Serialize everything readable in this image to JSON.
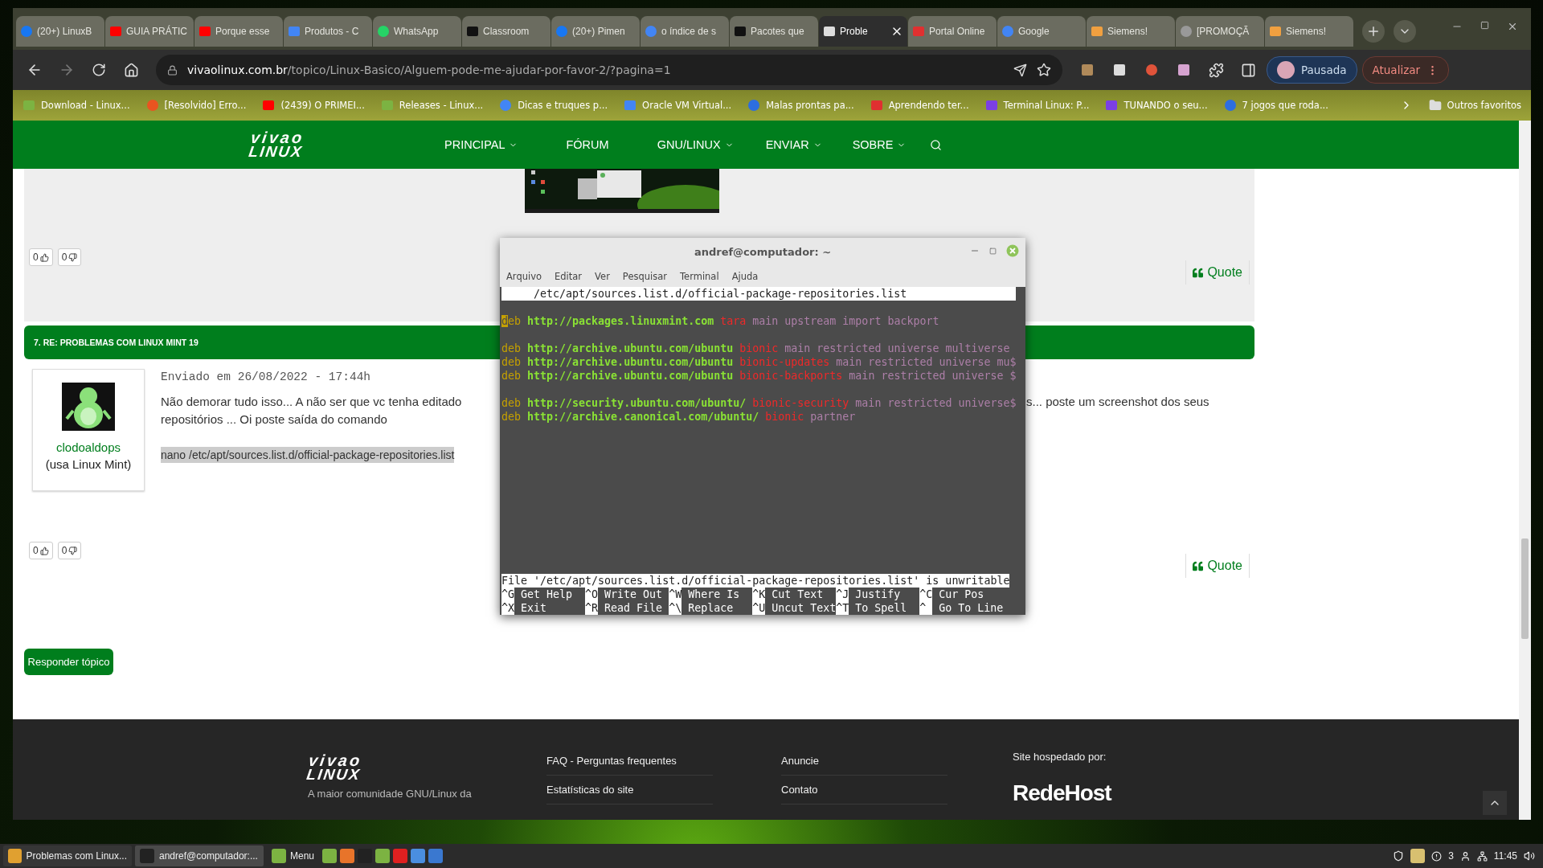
{
  "browser": {
    "tabs": [
      {
        "title": "(20+) LinuxB",
        "kind": "facebook",
        "selected": false
      },
      {
        "title": "GUIA PRÁTIC",
        "kind": "youtube",
        "selected": false
      },
      {
        "title": "Porque esse",
        "kind": "youtube",
        "selected": false
      },
      {
        "title": "Produtos - C",
        "kind": "doc",
        "selected": false
      },
      {
        "title": "WhatsApp",
        "kind": "whatsapp",
        "selected": false
      },
      {
        "title": "Classroom",
        "kind": "dark",
        "selected": false
      },
      {
        "title": "(20+) Pimen",
        "kind": "facebook",
        "selected": false
      },
      {
        "title": "o índice de s",
        "kind": "google",
        "selected": false
      },
      {
        "title": "Pacotes que",
        "kind": "dark",
        "selected": false
      },
      {
        "title": "Proble",
        "kind": "penguin",
        "selected": true
      },
      {
        "title": "Portal Online",
        "kind": "red",
        "selected": false
      },
      {
        "title": "Google",
        "kind": "google",
        "selected": false
      },
      {
        "title": "Siemens!",
        "kind": "orange",
        "selected": false
      },
      {
        "title": "[PROMOÇÃ",
        "kind": "globe",
        "selected": false
      },
      {
        "title": "Siemens!",
        "kind": "orange",
        "selected": false
      }
    ],
    "address": {
      "domain": "vivaolinux.com.br",
      "path": "/topico/Linux-Basico/Alguem-pode-me-ajudar-por-favor-2/?pagina=1"
    },
    "profile": "Pausada",
    "update": "Atualizar",
    "bookmarks": [
      {
        "title": "Download - Linux...",
        "kind": "mint"
      },
      {
        "title": "[Resolvido] Erro...",
        "kind": "ubuntu"
      },
      {
        "title": "(2439) O PRIMEI...",
        "kind": "youtube"
      },
      {
        "title": "Releases - Linux...",
        "kind": "mint"
      },
      {
        "title": "Dicas e truques p...",
        "kind": "google"
      },
      {
        "title": "Oracle VM Virtual...",
        "kind": "doc"
      },
      {
        "title": "Malas prontas pa...",
        "kind": "blue"
      },
      {
        "title": "Aprendendo ter...",
        "kind": "red"
      },
      {
        "title": "Terminal Linux: P...",
        "kind": "purple"
      },
      {
        "title": "TUNANDO o seu...",
        "kind": "purple"
      },
      {
        "title": "7 jogos que roda...",
        "kind": "blue"
      }
    ],
    "other_bookmarks": "Outros favoritos"
  },
  "site": {
    "logo": [
      "vivao",
      "LINUX"
    ],
    "nav": [
      {
        "label": "PRINCIPAL",
        "dropdown": true
      },
      {
        "label": "FÓRUM",
        "dropdown": false
      },
      {
        "label": "GNU/LINUX",
        "dropdown": true
      },
      {
        "label": "ENVIAR",
        "dropdown": true
      },
      {
        "label": "SOBRE",
        "dropdown": true
      }
    ],
    "previous_post": {
      "likes": "0",
      "dislikes": "0",
      "quote": "Quote"
    },
    "post": {
      "header": "7. RE: PROBLEMAS COM LINUX MINT 19",
      "author": "clodoaldops",
      "author_note": "(usa Linux Mint)",
      "date": "Enviado em 26/08/2022 - 17:44h",
      "line1_left": "Não demorar tudo isso... A não ser que vc tenha editado",
      "line1_right": "s... poste um screenshot dos seus",
      "line2": "repositórios ... Oi poste saída do comando",
      "code": "nano /etc/apt/sources.list.d/official-package-repositories.list",
      "likes": "0",
      "dislikes": "0",
      "quote": "Quote"
    },
    "reply_button": "Responder tópico",
    "footer": {
      "logo": [
        "vivao",
        "LINUX"
      ],
      "tagline": "A maior comunidade GNU/Linux da",
      "links_1": [
        "FAQ - Perguntas frequentes",
        "Estatísticas do site"
      ],
      "links_2": [
        "Anuncie",
        "Contato"
      ],
      "hosted_by": "Site hospedado por:",
      "host_logo": "RedeHost"
    }
  },
  "terminal": {
    "title": "andref@computador: ~",
    "menu": [
      "Arquivo",
      "Editar",
      "Ver",
      "Pesquisar",
      "Terminal",
      "Ajuda"
    ],
    "header": "/etc/apt/sources.list.d/official-package-repositories.list",
    "blocks": [
      [
        {
          "cursor": "d",
          "segments": [
            {
              "text": "eb",
              "kind": "keyword"
            },
            {
              "text": "http://packages.linuxmint.com",
              "kind": "url"
            },
            {
              "text": "tara",
              "kind": "release"
            },
            {
              "text": "main upstream import backport",
              "kind": "component"
            }
          ]
        }
      ],
      [
        {
          "segments": [
            {
              "text": "deb",
              "kind": "keyword"
            },
            {
              "text": "http://archive.ubuntu.com/ubuntu",
              "kind": "url"
            },
            {
              "text": "bionic",
              "kind": "release"
            },
            {
              "text": "main restricted universe multiverse",
              "kind": "component"
            }
          ]
        },
        {
          "segments": [
            {
              "text": "deb",
              "kind": "keyword"
            },
            {
              "text": "http://archive.ubuntu.com/ubuntu",
              "kind": "url"
            },
            {
              "text": "bionic-updates",
              "kind": "release"
            },
            {
              "text": "main restricted universe mu$",
              "kind": "component"
            }
          ]
        },
        {
          "segments": [
            {
              "text": "deb",
              "kind": "keyword"
            },
            {
              "text": "http://archive.ubuntu.com/ubuntu",
              "kind": "url"
            },
            {
              "text": "bionic-backports",
              "kind": "release"
            },
            {
              "text": "main restricted universe $",
              "kind": "component"
            }
          ]
        }
      ],
      [
        {
          "segments": [
            {
              "text": "deb",
              "kind": "keyword"
            },
            {
              "text": "http://security.ubuntu.com/ubuntu/",
              "kind": "url"
            },
            {
              "text": "bionic-security",
              "kind": "release"
            },
            {
              "text": "main restricted universe$",
              "kind": "component"
            }
          ]
        },
        {
          "segments": [
            {
              "text": "deb",
              "kind": "keyword"
            },
            {
              "text": "http://archive.canonical.com/ubuntu/",
              "kind": "url"
            },
            {
              "text": "bionic",
              "kind": "release"
            },
            {
              "text": "partner",
              "kind": "component"
            }
          ]
        }
      ]
    ],
    "status": "File '/etc/apt/sources.list.d/official-package-repositories.list' is unwritable",
    "shortcuts": [
      [
        {
          "key": "^G",
          "label": "Get Help"
        },
        {
          "key": "^O",
          "label": "Write Out"
        },
        {
          "key": "^W",
          "label": "Where Is"
        },
        {
          "key": "^K",
          "label": "Cut Text"
        },
        {
          "key": "^J",
          "label": "Justify"
        },
        {
          "key": "^C",
          "label": "Cur Pos"
        }
      ],
      [
        {
          "key": "^X",
          "label": "Exit"
        },
        {
          "key": "^R",
          "label": "Read File"
        },
        {
          "key": "^\\",
          "label": "Replace"
        },
        {
          "key": "^U",
          "label": "Uncut Text"
        },
        {
          "key": "^T",
          "label": "To Spell"
        },
        {
          "key": "^",
          "label": "Go To Line"
        }
      ]
    ]
  },
  "taskbar": {
    "windows": [
      {
        "title": "Problemas com Linux...",
        "kind": "browser",
        "selected": false
      },
      {
        "title": "andref@computador:...",
        "kind": "terminal",
        "selected": true
      }
    ],
    "menu": "Menu",
    "notifications": "3",
    "clock": "11:45"
  }
}
